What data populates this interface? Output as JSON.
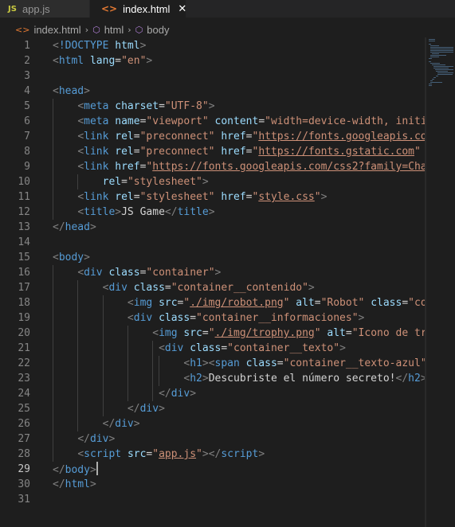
{
  "tabs": [
    {
      "label": "app.js",
      "icon": "js-file-icon",
      "active": false
    },
    {
      "label": "index.html",
      "icon": "html-file-icon",
      "active": true
    }
  ],
  "tab_icons": {
    "js": "JS",
    "html": "<>",
    "close": "✕"
  },
  "breadcrumb": {
    "items": [
      "index.html",
      "html",
      "body"
    ],
    "separator": "›",
    "cube_glyph": "⬡"
  },
  "editor": {
    "current_line": 29,
    "line_numbers": [
      "1",
      "2",
      "3",
      "4",
      "5",
      "6",
      "7",
      "8",
      "9",
      "10",
      "11",
      "12",
      "13",
      "14",
      "15",
      "16",
      "17",
      "18",
      "19",
      "20",
      "21",
      "22",
      "23",
      "24",
      "25",
      "26",
      "27",
      "28",
      "29",
      "30",
      "31"
    ],
    "lines": [
      [
        [
          "br",
          "<"
        ],
        [
          "tg",
          "!DOCTYPE"
        ],
        [
          "tx",
          " "
        ],
        [
          "at",
          "html"
        ],
        [
          "br",
          ">"
        ]
      ],
      [
        [
          "br",
          "<"
        ],
        [
          "tg",
          "html"
        ],
        [
          "tx",
          " "
        ],
        [
          "at",
          "lang"
        ],
        [
          "tx",
          "="
        ],
        [
          "st",
          "\"en\""
        ],
        [
          "br",
          ">"
        ]
      ],
      [],
      [
        [
          "br",
          "<"
        ],
        [
          "tg",
          "head"
        ],
        [
          "br",
          ">"
        ]
      ],
      [
        [
          "tx",
          "    "
        ],
        [
          "br",
          "<"
        ],
        [
          "tg",
          "meta"
        ],
        [
          "tx",
          " "
        ],
        [
          "at",
          "charset"
        ],
        [
          "tx",
          "="
        ],
        [
          "st",
          "\"UTF-8\""
        ],
        [
          "br",
          ">"
        ]
      ],
      [
        [
          "tx",
          "    "
        ],
        [
          "br",
          "<"
        ],
        [
          "tg",
          "meta"
        ],
        [
          "tx",
          " "
        ],
        [
          "at",
          "name"
        ],
        [
          "tx",
          "="
        ],
        [
          "st",
          "\"viewport\""
        ],
        [
          "tx",
          " "
        ],
        [
          "at",
          "content"
        ],
        [
          "tx",
          "="
        ],
        [
          "st",
          "\"width=device-width, initia"
        ]
      ],
      [
        [
          "tx",
          "    "
        ],
        [
          "br",
          "<"
        ],
        [
          "tg",
          "link"
        ],
        [
          "tx",
          " "
        ],
        [
          "at",
          "rel"
        ],
        [
          "tx",
          "="
        ],
        [
          "st",
          "\"preconnect\""
        ],
        [
          "tx",
          " "
        ],
        [
          "at",
          "href"
        ],
        [
          "tx",
          "="
        ],
        [
          "st",
          "\""
        ],
        [
          "stu",
          "https://fonts.googleapis.com"
        ]
      ],
      [
        [
          "tx",
          "    "
        ],
        [
          "br",
          "<"
        ],
        [
          "tg",
          "link"
        ],
        [
          "tx",
          " "
        ],
        [
          "at",
          "rel"
        ],
        [
          "tx",
          "="
        ],
        [
          "st",
          "\"preconnect\""
        ],
        [
          "tx",
          " "
        ],
        [
          "at",
          "href"
        ],
        [
          "tx",
          "="
        ],
        [
          "st",
          "\""
        ],
        [
          "stu",
          "https://fonts.gstatic.com"
        ],
        [
          "st",
          "\""
        ],
        [
          "tx",
          " "
        ],
        [
          "at",
          "c"
        ]
      ],
      [
        [
          "tx",
          "    "
        ],
        [
          "br",
          "<"
        ],
        [
          "tg",
          "link"
        ],
        [
          "tx",
          " "
        ],
        [
          "at",
          "href"
        ],
        [
          "tx",
          "="
        ],
        [
          "st",
          "\""
        ],
        [
          "stu",
          "https://fonts.googleapis.com/css2?family=Chak"
        ]
      ],
      [
        [
          "tx",
          "        "
        ],
        [
          "at",
          "rel"
        ],
        [
          "tx",
          "="
        ],
        [
          "st",
          "\"stylesheet\""
        ],
        [
          "br",
          ">"
        ]
      ],
      [
        [
          "tx",
          "    "
        ],
        [
          "br",
          "<"
        ],
        [
          "tg",
          "link"
        ],
        [
          "tx",
          " "
        ],
        [
          "at",
          "rel"
        ],
        [
          "tx",
          "="
        ],
        [
          "st",
          "\"stylesheet\""
        ],
        [
          "tx",
          " "
        ],
        [
          "at",
          "href"
        ],
        [
          "tx",
          "="
        ],
        [
          "st",
          "\""
        ],
        [
          "stu",
          "style.css"
        ],
        [
          "st",
          "\""
        ],
        [
          "br",
          ">"
        ]
      ],
      [
        [
          "tx",
          "    "
        ],
        [
          "br",
          "<"
        ],
        [
          "tg",
          "title"
        ],
        [
          "br",
          ">"
        ],
        [
          "tx",
          "JS Game"
        ],
        [
          "br",
          "</"
        ],
        [
          "tg",
          "title"
        ],
        [
          "br",
          ">"
        ]
      ],
      [
        [
          "br",
          "</"
        ],
        [
          "tg",
          "head"
        ],
        [
          "br",
          ">"
        ]
      ],
      [],
      [
        [
          "br",
          "<"
        ],
        [
          "tg",
          "body"
        ],
        [
          "br",
          ">"
        ]
      ],
      [
        [
          "tx",
          "    "
        ],
        [
          "br",
          "<"
        ],
        [
          "tg",
          "div"
        ],
        [
          "tx",
          " "
        ],
        [
          "at",
          "class"
        ],
        [
          "tx",
          "="
        ],
        [
          "st",
          "\"container\""
        ],
        [
          "br",
          ">"
        ]
      ],
      [
        [
          "tx",
          "        "
        ],
        [
          "br",
          "<"
        ],
        [
          "tg",
          "div"
        ],
        [
          "tx",
          " "
        ],
        [
          "at",
          "class"
        ],
        [
          "tx",
          "="
        ],
        [
          "st",
          "\"container__contenido\""
        ],
        [
          "br",
          ">"
        ]
      ],
      [
        [
          "tx",
          "            "
        ],
        [
          "br",
          "<"
        ],
        [
          "tg",
          "img"
        ],
        [
          "tx",
          " "
        ],
        [
          "at",
          "src"
        ],
        [
          "tx",
          "="
        ],
        [
          "st",
          "\""
        ],
        [
          "stu",
          "./img/robot.png"
        ],
        [
          "st",
          "\""
        ],
        [
          "tx",
          " "
        ],
        [
          "at",
          "alt"
        ],
        [
          "tx",
          "="
        ],
        [
          "st",
          "\"Robot\""
        ],
        [
          "tx",
          " "
        ],
        [
          "at",
          "class"
        ],
        [
          "tx",
          "="
        ],
        [
          "st",
          "\"con"
        ]
      ],
      [
        [
          "tx",
          "            "
        ],
        [
          "br",
          "<"
        ],
        [
          "tg",
          "div"
        ],
        [
          "tx",
          " "
        ],
        [
          "at",
          "class"
        ],
        [
          "tx",
          "="
        ],
        [
          "st",
          "\"container__informaciones\""
        ],
        [
          "br",
          ">"
        ]
      ],
      [
        [
          "tx",
          "                "
        ],
        [
          "br",
          "<"
        ],
        [
          "tg",
          "img"
        ],
        [
          "tx",
          " "
        ],
        [
          "at",
          "src"
        ],
        [
          "tx",
          "="
        ],
        [
          "st",
          "\""
        ],
        [
          "stu",
          "./img/trophy.png"
        ],
        [
          "st",
          "\""
        ],
        [
          "tx",
          " "
        ],
        [
          "at",
          "alt"
        ],
        [
          "tx",
          "="
        ],
        [
          "st",
          "\"Icono de tro"
        ]
      ],
      [
        [
          "tx",
          "                 "
        ],
        [
          "br",
          "<"
        ],
        [
          "tg",
          "div"
        ],
        [
          "tx",
          " "
        ],
        [
          "at",
          "class"
        ],
        [
          "tx",
          "="
        ],
        [
          "st",
          "\"container__texto\""
        ],
        [
          "br",
          ">"
        ]
      ],
      [
        [
          "tx",
          "                     "
        ],
        [
          "br",
          "<"
        ],
        [
          "tg",
          "h1"
        ],
        [
          "br",
          ">"
        ],
        [
          "br",
          "<"
        ],
        [
          "tg",
          "span"
        ],
        [
          "tx",
          " "
        ],
        [
          "at",
          "class"
        ],
        [
          "tx",
          "="
        ],
        [
          "st",
          "\"container__texto-azul\""
        ],
        [
          "br",
          ">"
        ],
        [
          "tx",
          "C"
        ]
      ],
      [
        [
          "tx",
          "                     "
        ],
        [
          "br",
          "<"
        ],
        [
          "tg",
          "h2"
        ],
        [
          "br",
          ">"
        ],
        [
          "tx",
          "Descubriste el número secreto!"
        ],
        [
          "br",
          "</"
        ],
        [
          "tg",
          "h2"
        ],
        [
          "br",
          ">"
        ]
      ],
      [
        [
          "tx",
          "                 "
        ],
        [
          "br",
          "</"
        ],
        [
          "tg",
          "div"
        ],
        [
          "br",
          ">"
        ]
      ],
      [
        [
          "tx",
          "            "
        ],
        [
          "br",
          "</"
        ],
        [
          "tg",
          "div"
        ],
        [
          "br",
          ">"
        ]
      ],
      [
        [
          "tx",
          "        "
        ],
        [
          "br",
          "</"
        ],
        [
          "tg",
          "div"
        ],
        [
          "br",
          ">"
        ]
      ],
      [
        [
          "tx",
          "    "
        ],
        [
          "br",
          "</"
        ],
        [
          "tg",
          "div"
        ],
        [
          "br",
          ">"
        ]
      ],
      [
        [
          "tx",
          "    "
        ],
        [
          "br",
          "<"
        ],
        [
          "tg",
          "script"
        ],
        [
          "tx",
          " "
        ],
        [
          "at",
          "src"
        ],
        [
          "tx",
          "="
        ],
        [
          "st",
          "\""
        ],
        [
          "stu",
          "app.js"
        ],
        [
          "st",
          "\""
        ],
        [
          "br",
          "></"
        ],
        [
          "tg",
          "script"
        ],
        [
          "br",
          ">"
        ]
      ],
      [
        [
          "br",
          "</"
        ],
        [
          "tg",
          "body"
        ],
        [
          "br",
          ">"
        ],
        [
          "cursor",
          ""
        ]
      ],
      [
        [
          "br",
          "</"
        ],
        [
          "tg",
          "html"
        ],
        [
          "br",
          ">"
        ]
      ],
      []
    ]
  }
}
